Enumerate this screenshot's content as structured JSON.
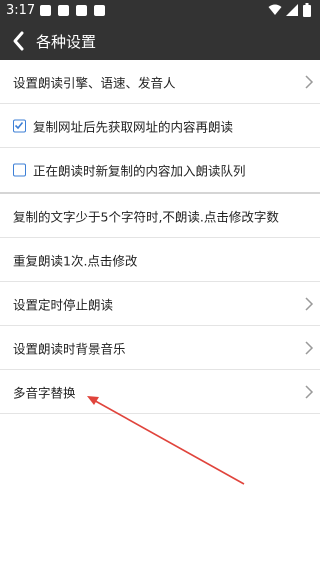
{
  "status_bar": {
    "time": "3:17",
    "icons": [
      "notification-icon",
      "font-icon",
      "a-icon",
      "square-icon",
      "wifi-icon",
      "signal-icon",
      "battery-icon"
    ]
  },
  "app_bar": {
    "title": "各种设置",
    "back_icon": "chevron-left-icon"
  },
  "settings": [
    {
      "label": "设置朗读引擎、语速、发音人",
      "type": "link"
    },
    {
      "label": "复制网址后先获取网址的内容再朗读",
      "type": "checkbox",
      "checked": true
    },
    {
      "label": "正在朗读时新复制的内容加入朗读队列",
      "type": "checkbox",
      "checked": false
    },
    {
      "label": "复制的文字少于5个字符时,不朗读.点击修改字数",
      "type": "text"
    },
    {
      "label": "重复朗读1次.点击修改",
      "type": "text"
    },
    {
      "label": "设置定时停止朗读",
      "type": "link"
    },
    {
      "label": "设置朗读时背景音乐",
      "type": "link"
    },
    {
      "label": "多音字替换",
      "type": "link"
    }
  ],
  "colors": {
    "bar": "#333333",
    "checkbox": "#3d7fd6",
    "annotation_arrow": "#e0443c"
  }
}
